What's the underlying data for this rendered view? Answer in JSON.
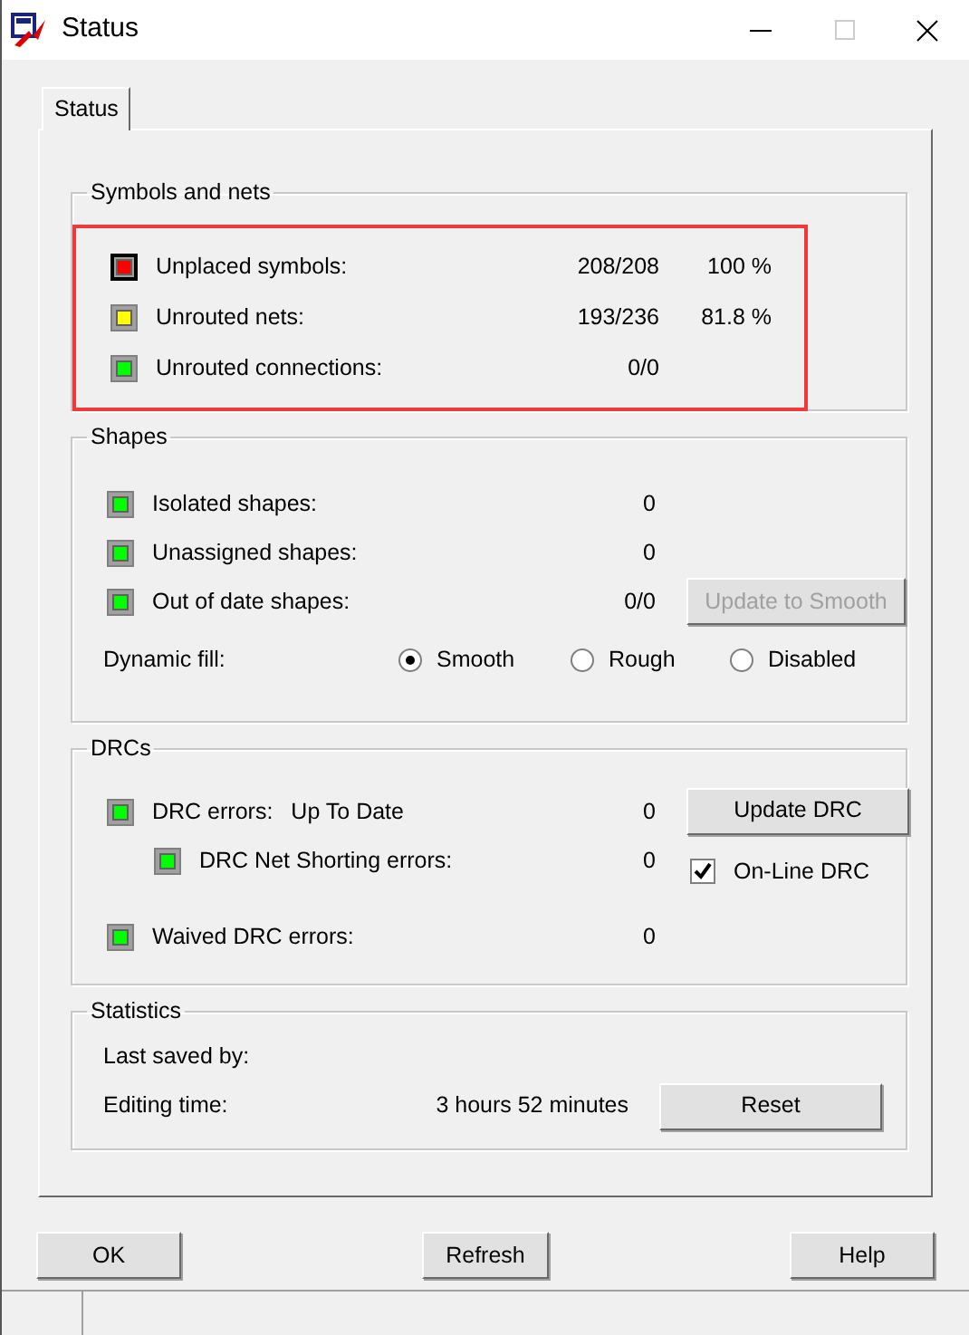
{
  "window": {
    "title": "Status"
  },
  "tabs": [
    {
      "label": "Status",
      "selected": true
    }
  ],
  "symbols_and_nets": {
    "title": "Symbols and nets",
    "highlighted": true,
    "rows": [
      {
        "label": "Unplaced symbols:",
        "value": "208/208",
        "percent": "100 %",
        "color": "#ff0000",
        "focused": true
      },
      {
        "label": "Unrouted nets:",
        "value": "193/236",
        "percent": "81.8 %",
        "color": "#ffff00",
        "focused": false
      },
      {
        "label": "Unrouted connections:",
        "value": "0/0",
        "color": "#00ff00",
        "focused": false
      }
    ]
  },
  "shapes": {
    "title": "Shapes",
    "rows": [
      {
        "label": "Isolated shapes:",
        "value": "0",
        "color": "#00ff00"
      },
      {
        "label": "Unassigned shapes:",
        "value": "0",
        "color": "#00ff00"
      },
      {
        "label": "Out of date shapes:",
        "value": "0/0",
        "color": "#00ff00"
      }
    ],
    "update_button": {
      "label": "Update to Smooth",
      "disabled": true
    },
    "dynamic_fill": {
      "label": "Dynamic fill:",
      "options": [
        {
          "label": "Smooth",
          "selected": true
        },
        {
          "label": "Rough",
          "selected": false
        },
        {
          "label": "Disabled",
          "selected": false
        }
      ]
    }
  },
  "drcs": {
    "title": "DRCs",
    "rows": [
      {
        "label": "DRC errors:",
        "status": "Up To Date",
        "value": "0",
        "color": "#00ff00",
        "children": [
          {
            "label": "DRC Net Shorting errors:",
            "value": "0",
            "color": "#00ff00"
          }
        ]
      },
      {
        "label": "Waived DRC errors:",
        "value": "0",
        "color": "#00ff00"
      }
    ],
    "update_button": {
      "label": "Update DRC",
      "disabled": false
    },
    "online_drc": {
      "label": "On-Line DRC",
      "checked": true
    }
  },
  "statistics": {
    "title": "Statistics",
    "last_saved_label": "Last saved by:",
    "editing_time_label": "Editing time:",
    "editing_time": "3 hours 52 minutes",
    "reset_button": "Reset"
  },
  "buttons": [
    "OK",
    "Refresh",
    "Help"
  ]
}
